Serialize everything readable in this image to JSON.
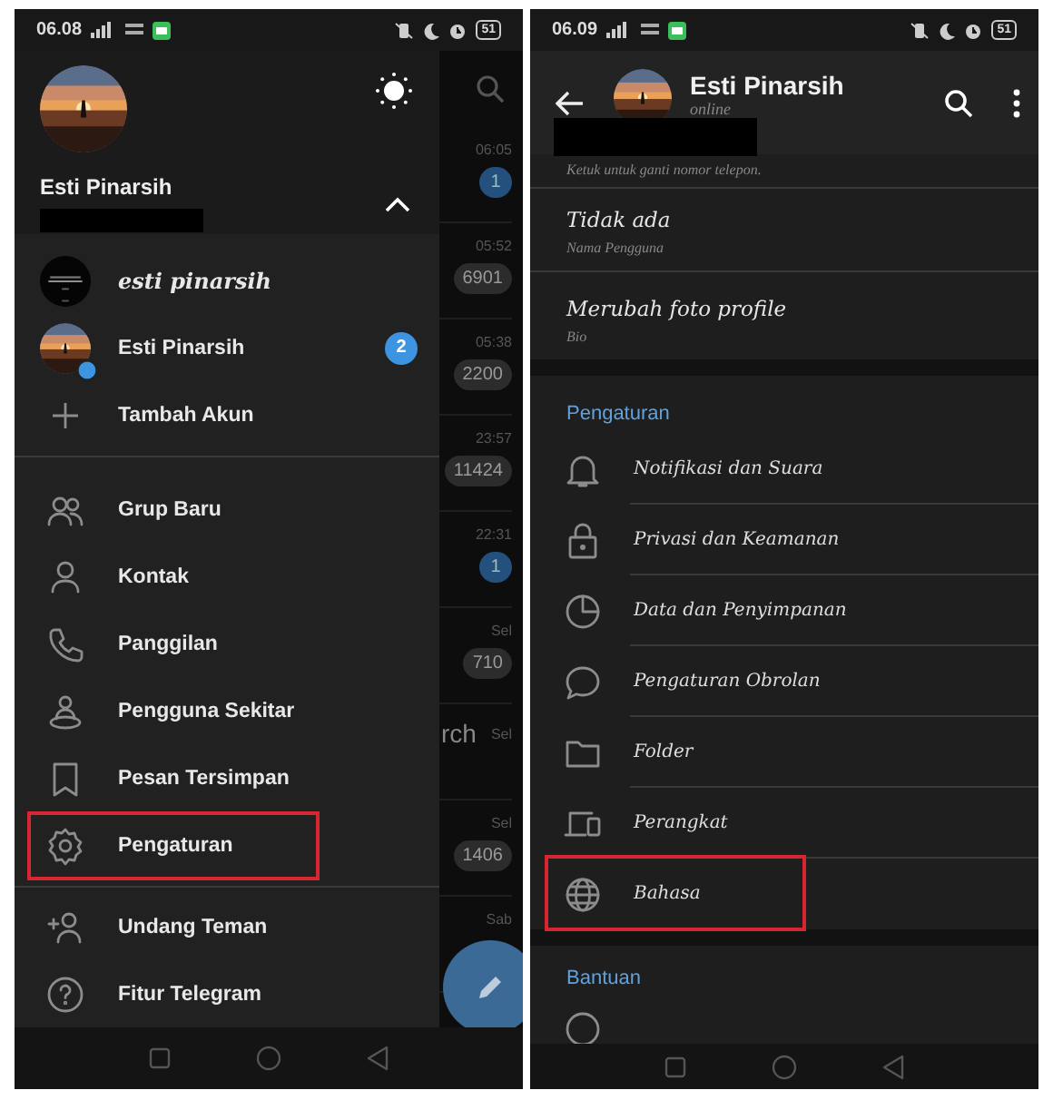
{
  "left_phone": {
    "status_bar": {
      "time": "06.08",
      "battery": "51"
    },
    "chat_list": [
      {
        "time": "06:05",
        "count": "1",
        "muted": false
      },
      {
        "time": "05:52",
        "count": "6901",
        "muted": true
      },
      {
        "time": "05:38",
        "count": "2200",
        "muted": true
      },
      {
        "time": "23:57",
        "count": "11424",
        "muted": true
      },
      {
        "time": "22:31",
        "count": "1",
        "muted": false
      },
      {
        "time": "Sel",
        "count": "710",
        "muted": true
      },
      {
        "time": "Sel",
        "title_fragment": "rch"
      },
      {
        "time": "Sel",
        "count": "1406",
        "muted": true
      },
      {
        "time": "Sab"
      }
    ],
    "drawer": {
      "profile_name": "Esti Pinarsih",
      "accounts_expanded": true,
      "accounts": [
        {
          "name": "esti pinarsih",
          "kind": "account",
          "active": false
        },
        {
          "name": "Esti Pinarsih",
          "kind": "account",
          "active": true,
          "badge": "2"
        },
        {
          "name": "Tambah Akun",
          "kind": "add"
        }
      ],
      "menu": [
        {
          "label": "Grup Baru",
          "kind": "group",
          "highlighted": false
        },
        {
          "label": "Kontak",
          "kind": "person",
          "highlighted": false
        },
        {
          "label": "Panggilan",
          "kind": "phone",
          "highlighted": false
        },
        {
          "label": "Pengguna Sekitar",
          "kind": "nearby",
          "highlighted": false
        },
        {
          "label": "Pesan Tersimpan",
          "kind": "bookmark",
          "highlighted": false
        },
        {
          "label": "Pengaturan",
          "kind": "gear",
          "highlighted": true
        }
      ],
      "footer_menu": [
        {
          "label": "Undang Teman",
          "kind": "add-person",
          "highlighted": false
        },
        {
          "label": "Fitur Telegram",
          "kind": "help",
          "highlighted": false
        }
      ]
    }
  },
  "right_phone": {
    "status_bar": {
      "time": "06.09",
      "battery": "51"
    },
    "header": {
      "name": "Esti Pinarsih",
      "status": "online"
    },
    "account_rows": [
      {
        "subtitle": "Ketuk untuk ganti nomor telepon."
      },
      {
        "title": "Tidak ada",
        "subtitle": "Nama Pengguna"
      },
      {
        "title": "Merubah foto profile",
        "subtitle": "Bio"
      }
    ],
    "sections": [
      {
        "heading": "Pengaturan",
        "items": [
          {
            "label": "Notifikasi dan Suara",
            "kind": "bell",
            "highlighted": false
          },
          {
            "label": "Privasi dan Keamanan",
            "kind": "lock",
            "highlighted": false
          },
          {
            "label": "Data dan Penyimpanan",
            "kind": "pie",
            "highlighted": false
          },
          {
            "label": "Pengaturan Obrolan",
            "kind": "chat",
            "highlighted": false
          },
          {
            "label": "Folder",
            "kind": "folder",
            "highlighted": false
          },
          {
            "label": "Perangkat",
            "kind": "devices",
            "highlighted": false
          },
          {
            "label": "Bahasa",
            "kind": "globe",
            "highlighted": true
          }
        ]
      },
      {
        "heading": "Bantuan",
        "items": [
          {
            "kind": "circle"
          }
        ]
      }
    ]
  }
}
